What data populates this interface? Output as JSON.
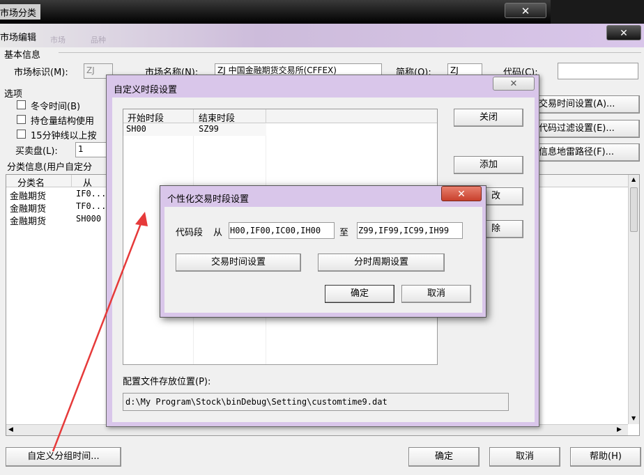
{
  "outer_window": {
    "title": "市场分类",
    "close": "✕"
  },
  "market_editor": {
    "title": "市场编辑",
    "faded_menu": [
      "市场",
      "品种"
    ],
    "close": "✕",
    "basic_info_label": "基本信息",
    "market_id_label": "市场标识(M):",
    "market_id_value": "ZJ",
    "market_name_label": "市场名称(N):",
    "market_name_value": "ZJ 中国金融期货交易所(CFFEX)",
    "short_name_label": "简称(O):",
    "short_name_value": "ZJ",
    "code_label": "代码(C):",
    "code_value": "",
    "options_label": "选项",
    "option_winter": "冬令时间(B)",
    "option_position": "持仓量结构使用",
    "option_15min": "15分钟线以上按",
    "bidask_label": "买卖盘(L):",
    "bidask_value": "1",
    "class_info_label": "分类信息(用户自定分",
    "right_buttons": [
      "交易时间设置(A)...",
      "代码过滤设置(E)...",
      "信息地雷路径(F)..."
    ],
    "table": {
      "headers": [
        "分类名",
        "从"
      ],
      "rows": [
        [
          "金融期货",
          "IF0..."
        ],
        [
          "金融期货",
          "TF0..."
        ],
        [
          "金融期货",
          "SH000"
        ]
      ]
    },
    "bottom_left_button": "自定义分组时间...",
    "ok": "确定",
    "cancel": "取消",
    "help": "帮助(H)"
  },
  "custom_dialog": {
    "title": "自定义时段设置",
    "close": "✕",
    "headers": [
      "开始时段",
      "结束时段"
    ],
    "rows": [
      [
        "SH00",
        "SZ99"
      ]
    ],
    "buttons": {
      "close": "关闭",
      "add": "添加",
      "modify_partial": "改",
      "delete_partial": "除"
    },
    "config_label": "配置文件存放位置(P):",
    "config_path": "d:\\My Program\\Stock\\binDebug\\Setting\\customtime9.dat"
  },
  "personal_dialog": {
    "title": "个性化交易时段设置",
    "close": "✕",
    "code_range_label": "代码段",
    "from_label": "从",
    "from_value": "H00,IF00,IC00,IH00",
    "to_label": "至",
    "to_value": "Z99,IF99,IC99,IH99",
    "trade_time_button": "交易时间设置",
    "period_button": "分时周期设置",
    "ok": "确定",
    "cancel": "取消"
  },
  "colors": {
    "title_bar": "#000000",
    "dialog_frame": "#d9c6ea",
    "close_red": "#c8402c",
    "arrow": "#e63a3a"
  }
}
